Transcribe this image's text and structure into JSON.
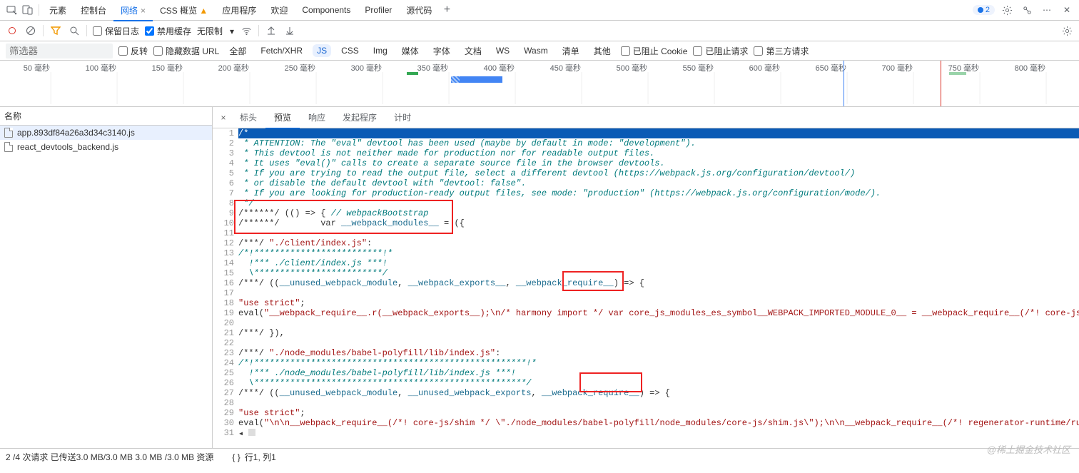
{
  "tabs": {
    "elements": "元素",
    "console": "控制台",
    "network": "网络",
    "css_overview": "CSS 概览",
    "application": "应用程序",
    "welcome": "欢迎",
    "components": "Components",
    "profiler": "Profiler",
    "sources": "源代码"
  },
  "badge_count": "2",
  "toolbar": {
    "preserve_log": "保留日志",
    "disable_cache": "禁用缓存",
    "throttle": "无限制"
  },
  "filter": {
    "placeholder": "筛选器",
    "invert": "反转",
    "hide_data_urls": "隐藏数据 URL",
    "all": "全部",
    "fetch_xhr": "Fetch/XHR",
    "js": "JS",
    "css": "CSS",
    "img": "Img",
    "media": "媒体",
    "font": "字体",
    "doc": "文档",
    "ws": "WS",
    "wasm": "Wasm",
    "manifest": "清单",
    "other": "其他",
    "blocked_cookies": "已阻止 Cookie",
    "blocked_requests": "已阻止请求",
    "third_party": "第三方请求"
  },
  "timeline": {
    "ticks": [
      "50 毫秒",
      "100 毫秒",
      "150 毫秒",
      "200 毫秒",
      "250 毫秒",
      "300 毫秒",
      "350 毫秒",
      "400 毫秒",
      "450 毫秒",
      "500 毫秒",
      "550 毫秒",
      "600 毫秒",
      "650 毫秒",
      "700 毫秒",
      "750 毫秒",
      "800 毫秒"
    ]
  },
  "sidebar": {
    "header": "名称",
    "files": [
      "app.893df84a26a3d34c3140.js",
      "react_devtools_backend.js"
    ]
  },
  "main_tabs": {
    "headers": "标头",
    "preview": "预览",
    "response": "响应",
    "initiator": "发起程序",
    "timing": "计时"
  },
  "code": {
    "l1": "/*",
    "l2": " * ATTENTION: The \"eval\" devtool has been used (maybe by default in mode: \"development\").",
    "l3": " * This devtool is not neither made for production nor for readable output files.",
    "l4": " * It uses \"eval()\" calls to create a separate source file in the browser devtools.",
    "l5": " * If you are trying to read the output file, select a different devtool (https://webpack.js.org/configuration/devtool/)",
    "l6": " * or disable the default devtool with \"devtool: false\".",
    "l7": " * If you are looking for production-ready output files, see mode: \"production\" (https://webpack.js.org/configuration/mode/).",
    "l8": " */",
    "l9a": "/******/ (() => { ",
    "l9b": "// webpackBootstrap",
    "l10a": "/******/ \tvar ",
    "l10b": "__webpack_modules__",
    "l10c": " = ({",
    "l12a": "/***/ ",
    "l12b": "\"./client/index.js\"",
    "l12c": ":",
    "l13": "/*!*************************!*",
    "l14": "  !*** ./client/index.js ***!",
    "l15": "  \\*************************/",
    "l16a": "/***/ ((",
    "l16b": "__unused_webpack_module",
    "l16c": ", ",
    "l16d": "__webpack_exports__",
    "l16e": ", ",
    "l16f": "__webpack_require__",
    "l16g": ") => {",
    "l18a": "\"use strict\"",
    "l18b": ";",
    "l19a": "eval(",
    "l19b": "\"__webpack_require__.r(__webpack_exports__);\\n/* harmony import */ var core_js_modules_es_symbol__WEBPACK_IMPORTED_MODULE_0__ = __webpack_require__(/*! core-js/modules/es.symbo",
    "l21": "/***/ }),",
    "l23a": "/***/ ",
    "l23b": "\"./node_modules/babel-polyfill/lib/index.js\"",
    "l23c": ":",
    "l24": "/*!*****************************************************!*",
    "l25": "  !*** ./node_modules/babel-polyfill/lib/index.js ***!",
    "l26": "  \\*****************************************************/",
    "l27a": "/***/ ((",
    "l27b": "__unused_webpack_module",
    "l27c": ", ",
    "l27d": "__unused_webpack_exports",
    "l27e": ", ",
    "l27f": "__webpack_require__",
    "l27g": ") => {",
    "l29a": "\"use strict\"",
    "l29b": ";",
    "l30a": "eval(",
    "l30b": "\"\\n\\n__webpack_require__(/*! core-js/shim */ \\\"./node_modules/babel-polyfill/node_modules/core-js/shim.js\\\");\\n\\n__webpack_require__(/*! regenerator-runtime/runtime */ \\\"./node"
  },
  "status": {
    "summary": "2 /4 次请求  已传送3.0 MB/3.0 MB  3.0 MB /3.0 MB 资源",
    "braces": "{ }",
    "line_col": "行1, 列1"
  },
  "watermark": "@稀土掘金技术社区"
}
